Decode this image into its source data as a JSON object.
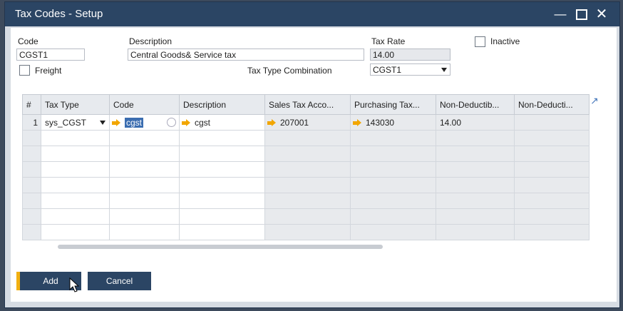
{
  "window": {
    "title": "Tax Codes - Setup"
  },
  "form": {
    "code_label": "Code",
    "code_value": "CGST1",
    "description_label": "Description",
    "description_value": "Central Goods& Service tax",
    "tax_rate_label": "Tax Rate",
    "tax_rate_value": "14.00",
    "inactive_label": "Inactive",
    "freight_label": "Freight",
    "tax_type_combination_label": "Tax Type Combination",
    "tax_type_combination_value": "CGST1"
  },
  "grid": {
    "headers": [
      "#",
      "Tax Type",
      "Code",
      "Description",
      "Sales Tax Acco...",
      "Purchasing Tax...",
      "Non-Deductib...",
      "Non-Deducti..."
    ],
    "row1": {
      "num": "1",
      "tax_type": "sys_CGST",
      "code": "cgst",
      "description": "cgst",
      "sales_tax_account": "207001",
      "purchasing_tax_account": "143030",
      "non_deductible": "14.00"
    }
  },
  "buttons": {
    "add": "Add",
    "cancel": "Cancel"
  },
  "colors": {
    "titlebar": "#2b4564",
    "accent": "#f2b010",
    "link_arrow": "#f2a600"
  }
}
